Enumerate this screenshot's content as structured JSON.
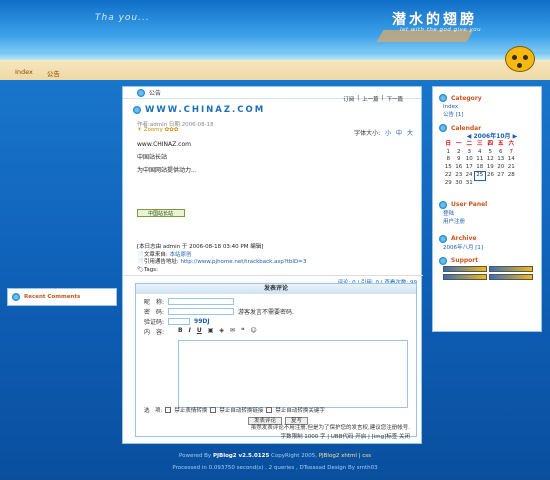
{
  "header": {
    "blog_title": "潜水的翅膀",
    "blog_subtitle": "let with the god give you",
    "logo_text": "Tha you..."
  },
  "topnav": [
    "Index",
    "公告"
  ],
  "main": {
    "section_label": "公告",
    "post_nav": [
      "订阅",
      "上一篇",
      "下一篇"
    ],
    "post_title": "WWW.CHINAZ.COM",
    "meta": "作者:admin 日期:2006-08-18",
    "stars_label": "Zoomy",
    "fontsize_label": "字体大小:",
    "fontsize_options": [
      "小",
      "中",
      "大"
    ],
    "body_lines": [
      "www.CHINAZ.com",
      "中国站长站",
      "为中国网站提供动力..."
    ],
    "badge_text": "中国站长站",
    "footer_edit": "[本日志由 admin 于 2006-08-18 03:40 PM 编辑]",
    "footer_source_label": "文章来自:",
    "footer_source": "本站原创",
    "footer_trackback_label": "引用通告地址:",
    "footer_trackback": "http://www.pjhome.net/trackback.asp?tbID=3",
    "tags_label": "Tags:",
    "counts": "评论: 0 | 引用: 0 | 查看次数: 99"
  },
  "comment": {
    "title": "发表评论",
    "nick_label": "昵　称:",
    "pwd_label": "密　码:",
    "pwd_hint": "游客发言不需要密码.",
    "code_label": "验证码:",
    "code_value": "99DJ",
    "content_label": "内　容:",
    "toolbar": [
      "B",
      "I",
      "U"
    ],
    "options_label": "选　项:",
    "options": [
      "禁止表情转换",
      "禁止自动转换链接",
      "禁止自动转换关键字"
    ],
    "submit_label": "发表评论",
    "reset_label": "复写",
    "note": "虽然发表评论不用注册,但是为了保护您的发言权,建议您注册帐号.",
    "limit": "字数限制 1000 字 | UBB代码 开启 | [img]标签 关闭"
  },
  "sidebar": {
    "category_title": "Category",
    "category_items": [
      "Index",
      "公告 [1]"
    ],
    "calendar_title": "Calendar",
    "calendar_month": "2006年10月",
    "calendar_headers": [
      "日",
      "一",
      "二",
      "三",
      "四",
      "五",
      "六"
    ],
    "calendar_rows": [
      [
        "1",
        "2",
        "3",
        "4",
        "5",
        "6",
        "7"
      ],
      [
        "8",
        "9",
        "10",
        "11",
        "12",
        "13",
        "14"
      ],
      [
        "15",
        "16",
        "17",
        "18",
        "19",
        "20",
        "21"
      ],
      [
        "22",
        "23",
        "24",
        "25",
        "26",
        "27",
        "28"
      ],
      [
        "29",
        "30",
        "31",
        "",
        "",
        "",
        ""
      ]
    ],
    "calendar_today": "25",
    "userpanel_title": "User Panel",
    "userpanel_items": [
      "登陆",
      "用户注册"
    ],
    "archive_title": "Archive",
    "archive_items": [
      "2006年八月 [1]"
    ],
    "support_title": "Support"
  },
  "recent_title": "Recent Comments",
  "footer": {
    "line1_prefix": "Powered By",
    "line1_pj": "PJBlog2 v2.5.0125",
    "line1_mid": "CopyRight 2005,",
    "line1_pj2": "PJBlog2",
    "line1_links": "xhtml | css",
    "line2": "Processed in 0.093750 second(s) , 2 queries , DTseasad Design By smth03"
  },
  "colors": {
    "accent": "#1a6fb8",
    "heading": "#c8551b",
    "bg": "#0e5fb6"
  }
}
